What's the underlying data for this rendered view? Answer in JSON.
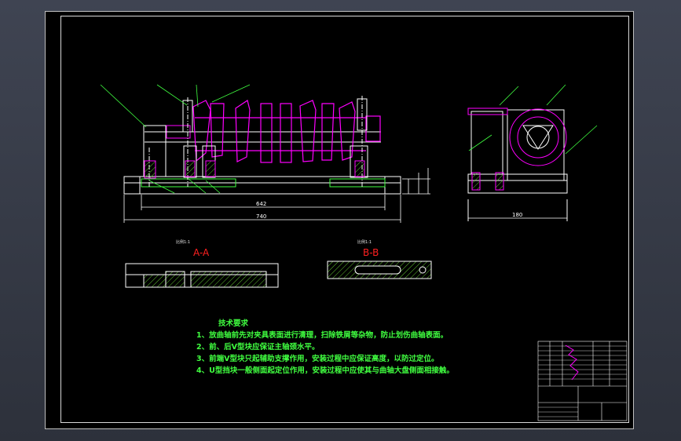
{
  "drawing": {
    "section_labels": {
      "aa": "A-A",
      "bb": "B-B"
    },
    "section_notes": {
      "aa": "比例1:1",
      "bb": "比例1:1"
    },
    "dimensions": {
      "inner_width": "642",
      "overall_width": "740",
      "side_width": "180"
    },
    "requirements": {
      "title": "技术要求",
      "items": [
        "1、放曲轴前先对夹具表面进行清理，扫除铁屑等杂物，防止划伤曲轴表面。",
        "2、前、后V型块应保证主轴颈水平。",
        "3、前端V型块只起辅助支撑作用，安装过程中应保证高度，以防过定位。",
        "4、U型挡块一般侧面起定位作用，安装过程中应使其与曲轴大盘侧面相接触。"
      ]
    }
  },
  "colors": {
    "background": "#000000",
    "line": "#ffffff",
    "magenta": "#ff00ff",
    "green": "#40ff40",
    "red": "#ff2020",
    "hatch": "#60c030"
  }
}
